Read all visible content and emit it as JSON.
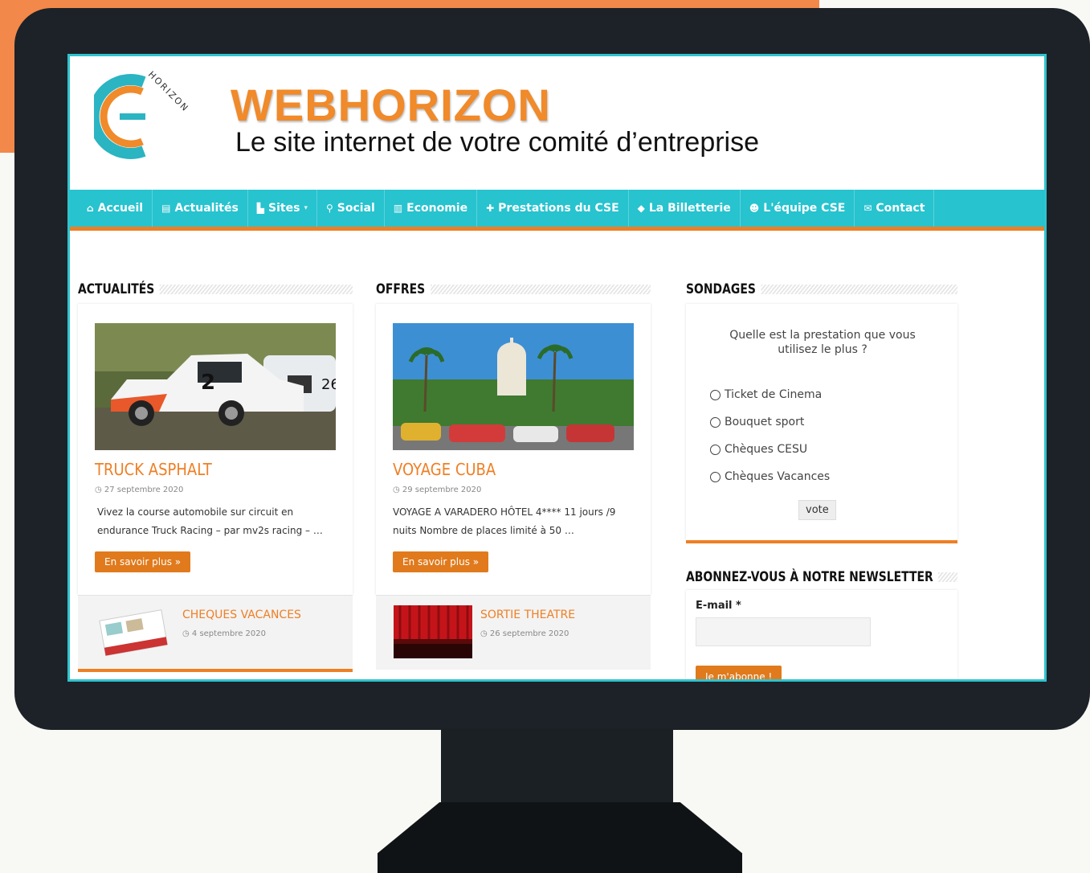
{
  "site": {
    "brand": "WEBHORIZON",
    "tagline": "Le site internet de votre comité d’entreprise",
    "logo_ring_text": "HORIZON",
    "accent": "#ef7f24",
    "nav_color": "#27c3cf"
  },
  "nav": [
    {
      "label": "Accueil",
      "icon": "home-icon",
      "glyph": "⌂"
    },
    {
      "label": "Actualités",
      "icon": "newspaper-icon",
      "glyph": "▤"
    },
    {
      "label": "Sites",
      "icon": "chart-icon",
      "glyph": "▙",
      "caret": "▾"
    },
    {
      "label": "Social",
      "icon": "pin-icon",
      "glyph": "⚲"
    },
    {
      "label": "Economie",
      "icon": "bar-chart-icon",
      "glyph": "▥"
    },
    {
      "label": "Prestations du CSE",
      "icon": "gift-icon",
      "glyph": "✚"
    },
    {
      "label": "La Billetterie",
      "icon": "ticket-icon",
      "glyph": "◆"
    },
    {
      "label": "L'équipe CSE",
      "icon": "group-icon",
      "glyph": "☻"
    },
    {
      "label": "Contact",
      "icon": "envelope-icon",
      "glyph": "✉"
    }
  ],
  "actualites": {
    "heading": "ACTUALITÉS",
    "main": {
      "title": "TRUCK ASPHALT",
      "date": "27 septembre 2020",
      "excerpt": "Vivez la course automobile sur circuit en endurance Truck Racing – par mv2s racing – …",
      "button": "En savoir plus »"
    },
    "secondary": {
      "title": "CHEQUES VACANCES",
      "date": "4 septembre 2020"
    }
  },
  "offres": {
    "heading": "OFFRES",
    "main": {
      "title": "VOYAGE CUBA",
      "date": "29 septembre 2020",
      "excerpt": "VOYAGE A VARADERO HÔTEL 4**** 11 jours /9 nuits Nombre de places limité à 50 …",
      "button": "En savoir plus »"
    },
    "secondary": {
      "title": "SORTIE THEATRE",
      "date": "26 septembre 2020"
    }
  },
  "sondages": {
    "heading": "SONDAGES",
    "question": "Quelle est la prestation que vous utilisez le plus ?",
    "options": [
      "Ticket de Cinema",
      "Bouquet sport",
      "Chèques CESU",
      "Chèques Vacances"
    ],
    "vote_label": "vote"
  },
  "newsletter": {
    "heading": "ABONNEZ-VOUS À NOTRE NEWSLETTER",
    "email_label": "E-mail *",
    "email_value": "",
    "button": "Je m'abonne !"
  }
}
